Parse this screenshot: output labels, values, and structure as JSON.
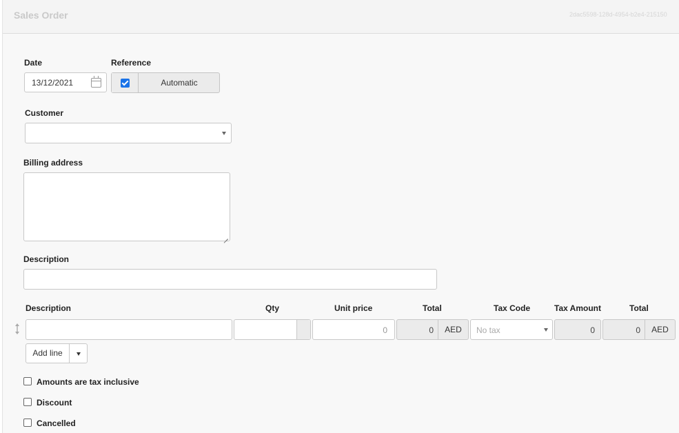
{
  "header": {
    "title": "Sales Order",
    "guid": "2dac5598-128d-4954-b2e4-215150"
  },
  "form": {
    "date_label": "Date",
    "date_value": "13/12/2021",
    "reference_label": "Reference",
    "reference_automatic_checked": true,
    "reference_automatic_label": "Automatic",
    "customer_label": "Customer",
    "customer_value": "",
    "billing_address_label": "Billing address",
    "billing_address_value": "",
    "description_label": "Description",
    "description_value": ""
  },
  "lines": {
    "columns": {
      "description": "Description",
      "qty": "Qty",
      "unit_price": "Unit price",
      "total": "Total",
      "tax_code": "Tax Code",
      "tax_amount": "Tax Amount",
      "total2": "Total"
    },
    "row": {
      "description": "",
      "qty": "",
      "unit_price_placeholder": "0",
      "total": "0",
      "total_currency": "AED",
      "tax_code_placeholder": "No tax",
      "tax_amount": "0",
      "total2": "0",
      "total2_currency": "AED"
    },
    "add_line_label": "Add line"
  },
  "options": [
    {
      "label": "Amounts are tax inclusive",
      "checked": false
    },
    {
      "label": "Discount",
      "checked": false
    },
    {
      "label": "Cancelled",
      "checked": false
    }
  ],
  "colors": {
    "checkbox_accent": "#1a73e8",
    "readonly_bg": "#ebebeb",
    "page_bg": "#f8f8f8"
  }
}
